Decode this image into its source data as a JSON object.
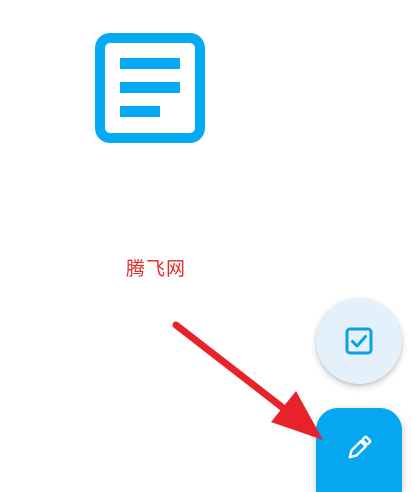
{
  "watermark": {
    "text": "腾飞网",
    "color": "#e52a2a"
  },
  "illustration": {
    "icon": "notes-icon",
    "color": "#05a9f4"
  },
  "fabs": {
    "secondary": {
      "icon": "checkbox-icon",
      "background": "#e4f1fb",
      "icon_color": "#0aa1e8"
    },
    "primary": {
      "icon": "pencil-icon",
      "background": "#06a6f0",
      "icon_color": "#ffffff"
    }
  },
  "annotation": {
    "type": "arrow",
    "color": "#e8222a"
  }
}
